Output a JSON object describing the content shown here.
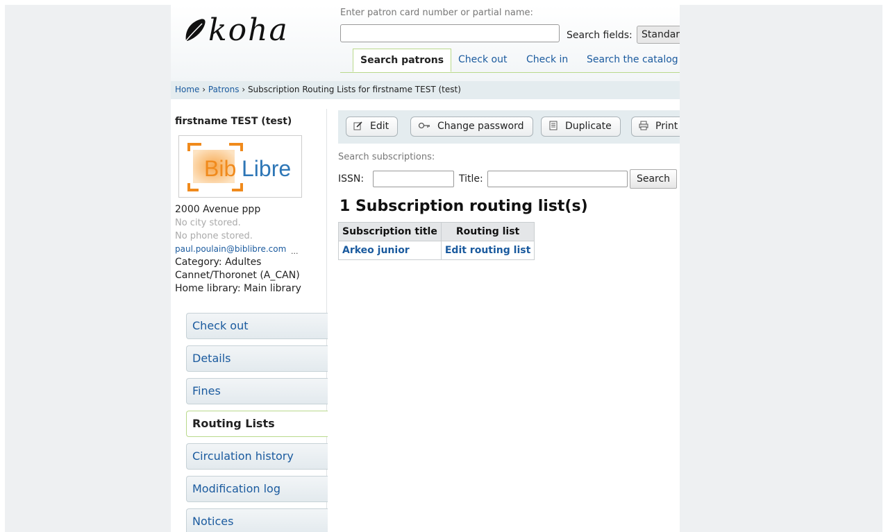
{
  "header": {
    "logo_text": "koha",
    "search_label": "Enter patron card number or partial name:",
    "search_value": "",
    "search_fields_label": "Search fields:",
    "search_fields_value": "Standar",
    "tabs": [
      {
        "label": "Search patrons"
      },
      {
        "label": "Check out"
      },
      {
        "label": "Check in"
      },
      {
        "label": "Search the catalog"
      }
    ]
  },
  "breadcrumb": {
    "home": "Home",
    "sep1": " › ",
    "patrons": "Patrons",
    "sep2": " › ",
    "current": "Subscription Routing Lists for firstname TEST (test)"
  },
  "patron": {
    "name": "firstname TEST (test)",
    "photo_logo": "BibLibre",
    "address": "2000 Avenue ppp",
    "city": "No city stored.",
    "phone": "No phone stored.",
    "email": "paul.poulain@biblibre.com",
    "more": "...",
    "category": "Category: Adultes",
    "category_detail": "Cannet/Thoronet (A_CAN)",
    "home_library": "Home library: Main library"
  },
  "menu": [
    {
      "label": "Check out"
    },
    {
      "label": "Details"
    },
    {
      "label": "Fines"
    },
    {
      "label": "Routing Lists"
    },
    {
      "label": "Circulation history"
    },
    {
      "label": "Modification log"
    },
    {
      "label": "Notices"
    }
  ],
  "toolbar": {
    "edit": "Edit",
    "change_password": "Change password",
    "duplicate": "Duplicate",
    "print": "Print"
  },
  "subscriptions": {
    "search_label": "Search subscriptions:",
    "issn_label": "ISSN:",
    "issn_value": "",
    "title_label": "Title:",
    "title_value": "",
    "search_button": "Search",
    "heading": "1 Subscription routing list(s)",
    "table": {
      "headers": [
        "Subscription title",
        "Routing list"
      ],
      "rows": [
        [
          "Arkeo junior",
          "Edit routing list"
        ]
      ]
    }
  },
  "colors": {
    "link": "#1a5a9e",
    "active_tab_border": "#b9d98b",
    "toolbar_bg": "#e4ecef"
  }
}
